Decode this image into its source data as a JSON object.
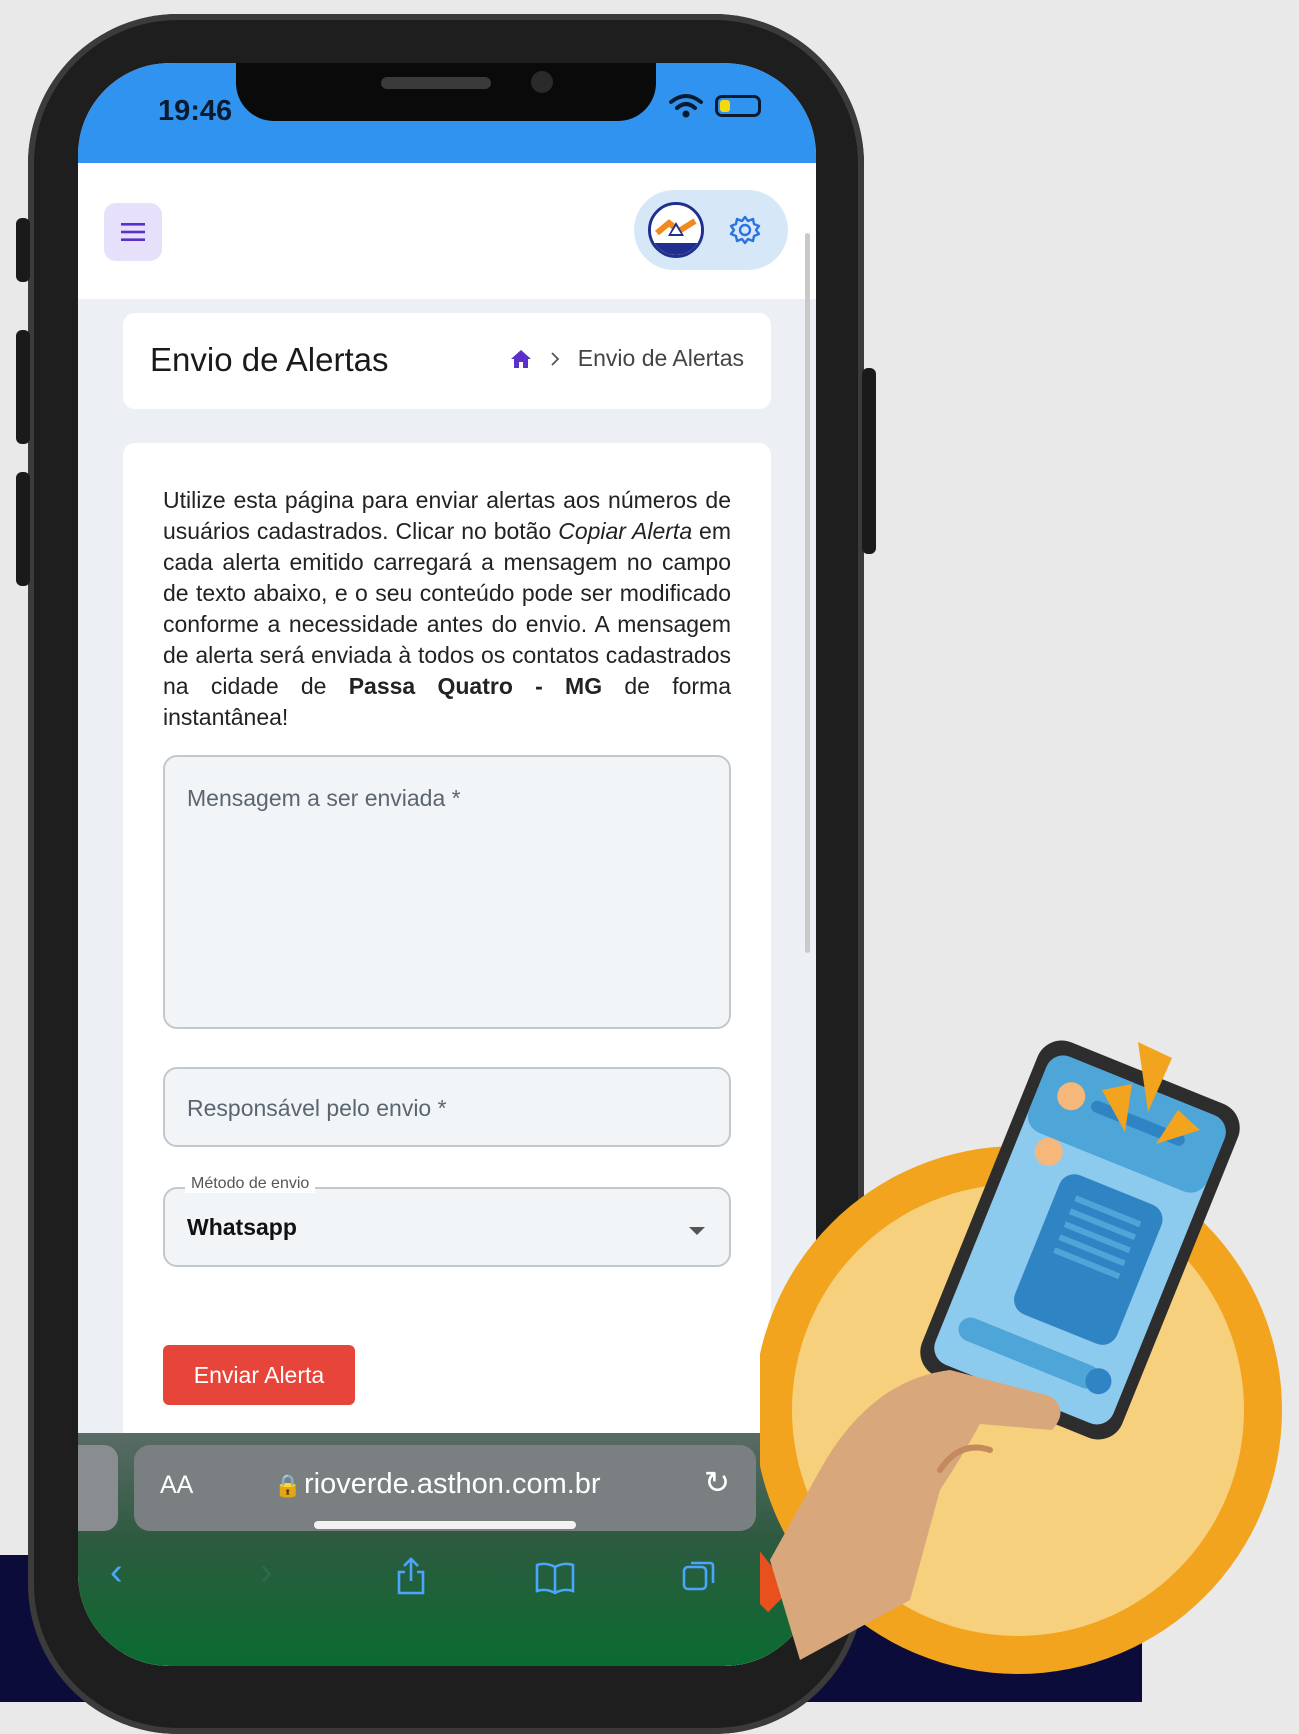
{
  "status_bar": {
    "time": "19:46"
  },
  "header": {
    "menu_icon": "hamburger-icon",
    "settings_icon": "gear-icon"
  },
  "page": {
    "title": "Envio de Alertas",
    "breadcrumb_current": "Envio de Alertas"
  },
  "description": {
    "part1": "Utilize esta página para enviar alertas aos números de usuários cadastrados. Clicar no botão ",
    "emphasis": "Copiar Alerta",
    "part2": " em cada alerta emitido carregará a mensagem no campo de texto abaixo, e o seu conteúdo pode ser modificado conforme a necessidade antes do envio. A mensagem de alerta será enviada à todos os contatos cadastrados na cidade de ",
    "city": "Passa Quatro - MG",
    "part3": " de forma instantânea!"
  },
  "form": {
    "message_placeholder": "Mensagem a ser enviada *",
    "responsible_placeholder": "Responsável pelo envio *",
    "method_label": "Método de envio",
    "method_value": "Whatsapp",
    "submit_label": "Enviar Alerta"
  },
  "browser": {
    "aa_label": "AA",
    "url": "rioverde.asthon.com.br"
  },
  "colors": {
    "statusbar": "#2f93ef",
    "accent_purple": "#5b2fc9",
    "submit": "#e8453a",
    "illustration_circle": "#f2a41f"
  }
}
